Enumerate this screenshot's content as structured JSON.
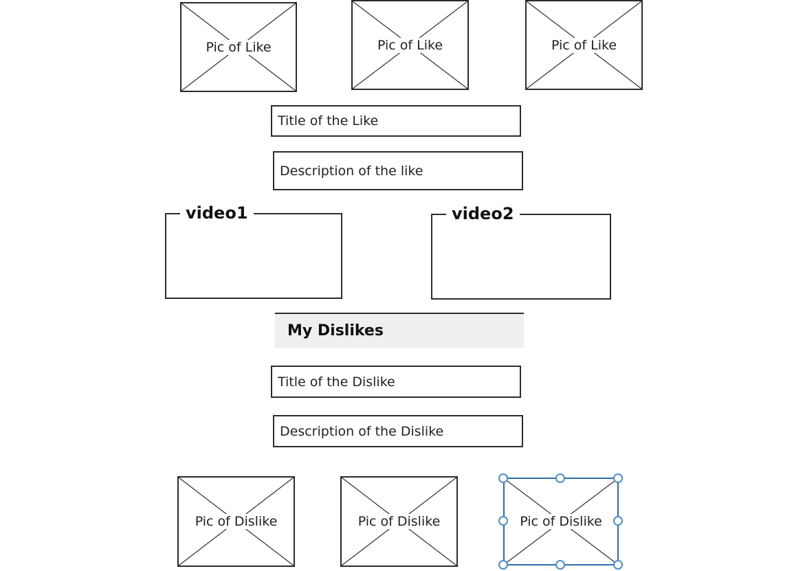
{
  "likes": {
    "pics": [
      {
        "label": "Pic of Like"
      },
      {
        "label": "Pic of Like"
      },
      {
        "label": "Pic of Like"
      }
    ],
    "title_field": "Title of the Like",
    "description_field": "Description of the like"
  },
  "videos": [
    {
      "label": "video1"
    },
    {
      "label": "video2"
    }
  ],
  "dislikes": {
    "header": "My Dislikes",
    "title_field": "Title of the Dislike",
    "description_field": "Description of the Dislike",
    "pics": [
      {
        "label": "Pic of Dislike"
      },
      {
        "label": "Pic of Dislike"
      },
      {
        "label": "Pic of Dislike",
        "selected": true
      }
    ]
  },
  "colors": {
    "border": "#2b2b2b",
    "section_header_bg": "#efefef",
    "selection": "#2a6db0"
  }
}
